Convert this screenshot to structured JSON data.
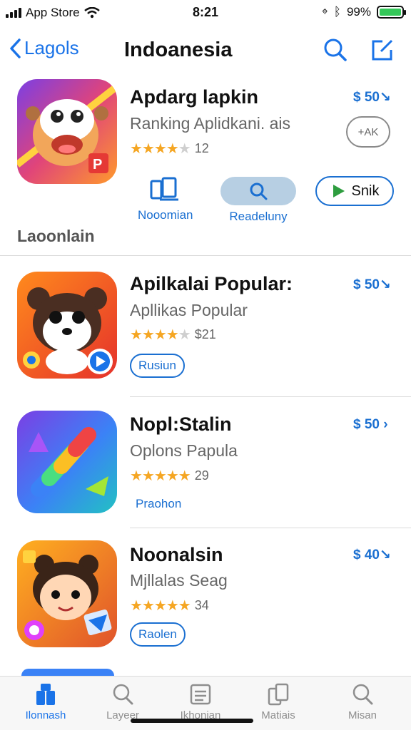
{
  "status_bar": {
    "carrier": "App Store",
    "time": "8:21",
    "battery": "99%",
    "battery_level": 0.99,
    "battery_color": "#34c759"
  },
  "nav": {
    "back_label": "Lagols",
    "title": "Indoanesia",
    "accent": "#1a73e8"
  },
  "featured": {
    "name": "Apdarg lapkin",
    "subtitle": "Ranking Aplidkani. ais",
    "rating": 4,
    "rating_count": "12",
    "price": "$ 50↘",
    "get_label": "+АK",
    "actions": [
      {
        "label": "Nooomian",
        "icon": "devices-icon"
      },
      {
        "label": "Readeluny",
        "icon": "search-icon"
      }
    ],
    "stream_label": "Snik",
    "icon": "cartoon-game-icon"
  },
  "section": {
    "label": "Laoonlain"
  },
  "apps": [
    {
      "name": "Apilkalai Popular:",
      "subtitle": "Apllikas Popular",
      "rating": 4.5,
      "rating_count": "$21",
      "price": "$ 50↘",
      "tag": "Rusiun",
      "tag_style": "outlined",
      "icon": "bear-play-icon"
    },
    {
      "name": "Nopl:Stalin",
      "subtitle": "Oplons Papula",
      "rating": 5,
      "rating_count": "29",
      "price": "$ 50 ›",
      "tag": "Praohon",
      "tag_style": "text",
      "icon": "paint-brush-icon"
    },
    {
      "name": "Noonalsin",
      "subtitle": "Mjllalas Seag",
      "rating": 5,
      "rating_count": "34",
      "price": "$ 40↘",
      "tag": "Raolen",
      "tag_style": "outlined",
      "icon": "cartoon-girl-icon"
    }
  ],
  "tab_bar": {
    "tabs": [
      {
        "label": "Ilonnash",
        "icon": "apps-icon",
        "active": true
      },
      {
        "label": "Layeer",
        "icon": "search-icon",
        "active": false
      },
      {
        "label": "Ikhonian",
        "icon": "list-icon",
        "active": false
      },
      {
        "label": "Matiais",
        "icon": "copy-icon",
        "active": false
      },
      {
        "label": "Misan",
        "icon": "search-icon",
        "active": false
      }
    ]
  }
}
